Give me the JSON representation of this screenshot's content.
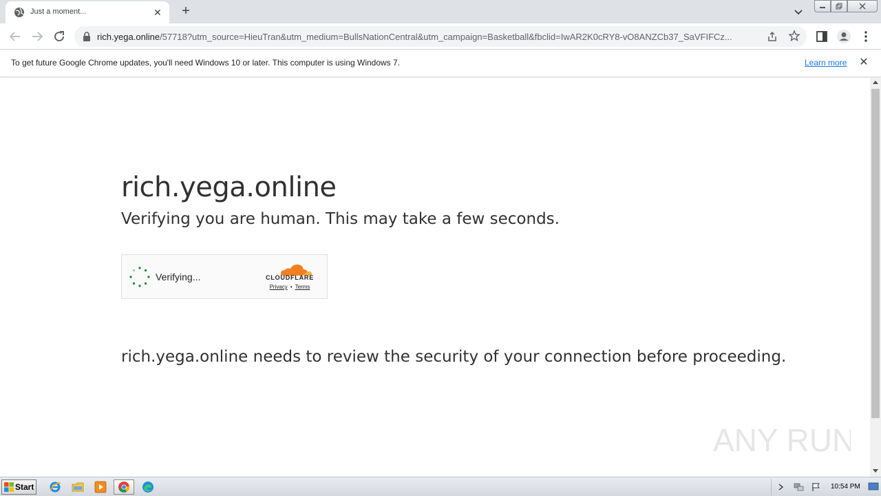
{
  "browser": {
    "tab_title": "Just a moment...",
    "url_host": "rich.yega.online",
    "url_rest": "/57718?utm_source=HieuTran&utm_medium=BullsNationCentral&utm_campaign=Basketball&fbclid=IwAR2K0cRY8-vO8ANZCb37_SaVFIFCz...",
    "icons": [
      "globe-icon",
      "close-icon",
      "plus-icon",
      "chevron-down-icon",
      "back-icon",
      "forward-icon",
      "reload-icon",
      "lock-icon",
      "share-icon",
      "star-icon",
      "side-panel-icon",
      "profile-icon",
      "more-icon"
    ]
  },
  "infobar": {
    "message": "To get future Google Chrome updates, you'll need Windows 10 or later. This computer is using Windows 7.",
    "learn_more": "Learn more"
  },
  "page": {
    "heading": "rich.yega.online",
    "subheading": "Verifying you are human. This may take a few seconds.",
    "widget": {
      "status": "Verifying...",
      "brand": "CLOUDFLARE",
      "privacy": "Privacy",
      "separator": "•",
      "terms": "Terms"
    },
    "security_text": "rich.yega.online needs to review the security of your connection before proceeding."
  },
  "watermark": "ANY RUN",
  "taskbar": {
    "start_label": "Start",
    "clock": "10:54 PM",
    "apps": [
      "ie-icon",
      "explorer-icon",
      "media-player-icon",
      "chrome-icon",
      "edge-icon"
    ]
  },
  "colors": {
    "cloudflare_orange": "#f38020",
    "spinner_green": "#1a7f37",
    "link_blue": "#1a73e8"
  }
}
